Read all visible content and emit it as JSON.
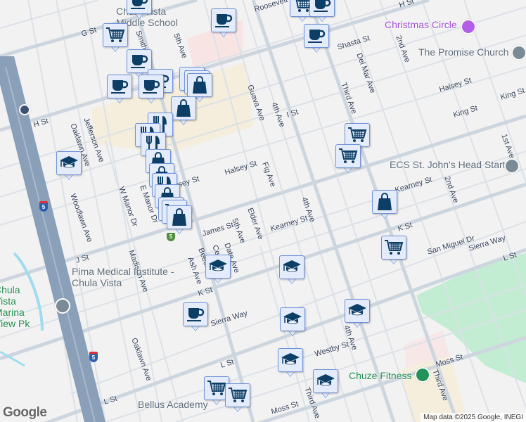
{
  "map": {
    "streets": [
      "G St",
      "Smith",
      "5th Ave",
      "Roosevelt St",
      "H St",
      "Shasta St",
      "Del Mar Ave",
      "2nd Ave",
      "Guava Ave",
      "4th Ave",
      "I St",
      "Third Ave",
      "Halsey St",
      "King St",
      "King St",
      "Halsey St",
      "1st Ave",
      "H St",
      "Jefferson Ave",
      "Oaklawn Ave",
      "Woodlawn Ave",
      "Halsey St",
      "Fig Ave",
      "W Manor Dr",
      "E Manor Dr",
      "Kearney St",
      "2nd Ave",
      "James St",
      "5th Ave",
      "Elder Ave",
      "Kearney St",
      "4th Ave",
      "K St",
      "Date Ave",
      "Cedar",
      "Beech",
      "Ash Ave",
      "J St",
      "Madison Ave",
      "San Miguel Dr",
      "Sierra Way",
      "L St",
      "K St",
      "Sierra Way",
      "Oaklawn Ave",
      "4th Ave",
      "L St",
      "Westby St",
      "Moss St",
      "Third Ave",
      "L St",
      "Moss St",
      "Third Ave"
    ],
    "places": [
      {
        "name": "Chula Vista Middle School",
        "style": "gray"
      },
      {
        "name": "Christmas Circle",
        "style": "purple"
      },
      {
        "name": "The Promise Church",
        "style": "gray"
      },
      {
        "name": "ECS St. John's Head Start",
        "style": "gray"
      },
      {
        "name": "Pima Medical Institute - Chula Vista",
        "style": "gray"
      },
      {
        "name": "Chula Vista Marina View Pk",
        "style": "green"
      },
      {
        "name": "Bellus Academy",
        "style": "gray"
      },
      {
        "name": "Chuze Fitness",
        "style": "green"
      }
    ],
    "markers": [
      "cup",
      "cup",
      "cart",
      "cup",
      "cup",
      "cart",
      "cup",
      "cup",
      "cup",
      "cup",
      "dining",
      "bag",
      "bag",
      "bag",
      "dining",
      "dining",
      "dining",
      "bag",
      "bag",
      "dining",
      "bag",
      "bag",
      "cart",
      "bag",
      "school",
      "cart",
      "cart",
      "bag",
      "cart",
      "school",
      "school",
      "school",
      "school",
      "school",
      "school",
      "cup",
      "cart",
      "cart"
    ],
    "highway_shield": "5",
    "attribution": "Map data ©2025 Google, INEGI",
    "logo": "Google",
    "colors": {
      "marker_bg": "#e4ecfb",
      "marker_border": "#6f93d8",
      "marker_icon": "#0d3e66",
      "park": "#bfeccf",
      "commercial": "#f5eedc",
      "freeway": "#8a9fb8"
    }
  }
}
